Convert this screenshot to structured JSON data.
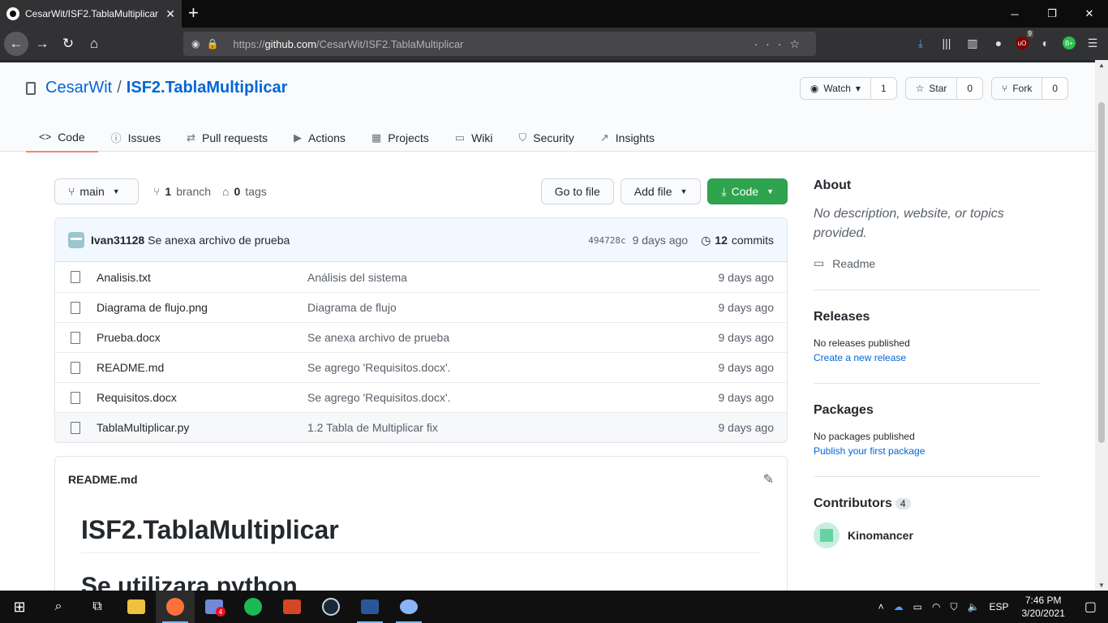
{
  "browser": {
    "tab_title": "CesarWit/ISF2.TablaMultiplicar",
    "tab_close": "✕",
    "new_tab": "+",
    "url_prefix": "https://",
    "url_domain": "github.com",
    "url_path": "/CesarWit/ISF2.TablaMultiplicar",
    "ubo_count": "9"
  },
  "repo": {
    "owner": "CesarWit",
    "separator": "/",
    "name": "ISF2.TablaMultiplicar",
    "watch_label": "Watch",
    "watch_count": "1",
    "star_label": "Star",
    "star_count": "0",
    "fork_label": "Fork",
    "fork_count": "0"
  },
  "tabs": [
    {
      "label": "Code",
      "icon": "code-icon"
    },
    {
      "label": "Issues",
      "icon": "issue-icon"
    },
    {
      "label": "Pull requests",
      "icon": "pull-request-icon"
    },
    {
      "label": "Actions",
      "icon": "play-icon"
    },
    {
      "label": "Projects",
      "icon": "project-icon"
    },
    {
      "label": "Wiki",
      "icon": "book-icon"
    },
    {
      "label": "Security",
      "icon": "shield-icon"
    },
    {
      "label": "Insights",
      "icon": "graph-icon"
    }
  ],
  "filenav": {
    "branch": "main",
    "branch_count": "1",
    "branch_label": "branch",
    "tag_count": "0",
    "tag_label": "tags",
    "go_to_file": "Go to file",
    "add_file": "Add file",
    "code": "Code"
  },
  "commit": {
    "author": "Ivan31128",
    "message": "Se anexa archivo de prueba",
    "sha": "494728c",
    "age": "9 days ago",
    "count": "12",
    "count_label": "commits"
  },
  "files": [
    {
      "name": "Analisis.txt",
      "message": "Análisis del sistema",
      "age": "9 days ago"
    },
    {
      "name": "Diagrama de flujo.png",
      "message": "Diagrama de flujo",
      "age": "9 days ago"
    },
    {
      "name": "Prueba.docx",
      "message": "Se anexa archivo de prueba",
      "age": "9 days ago"
    },
    {
      "name": "README.md",
      "message": "Se agrego 'Requisitos.docx'.",
      "age": "9 days ago"
    },
    {
      "name": "Requisitos.docx",
      "message": "Se agrego 'Requisitos.docx'.",
      "age": "9 days ago"
    },
    {
      "name": "TablaMultiplicar.py",
      "message": "1.2 Tabla de Multiplicar fix",
      "age": "9 days ago"
    }
  ],
  "readme": {
    "filename": "README.md",
    "h1": "ISF2.TablaMultiplicar",
    "h2": "Se utilizara python"
  },
  "sidebar": {
    "about_title": "About",
    "about_desc": "No description, website, or topics provided.",
    "readme_link": "Readme",
    "releases_title": "Releases",
    "releases_text": "No releases published",
    "releases_link": "Create a new release",
    "packages_title": "Packages",
    "packages_text": "No packages published",
    "packages_link": "Publish your first package",
    "contributors_title": "Contributors",
    "contributors_count": "4",
    "contributor_name": "Kinomancer"
  },
  "taskbar": {
    "lang": "ESP",
    "time": "7:46 PM",
    "date": "3/20/2021",
    "discord_badge": "4"
  },
  "colors": {
    "accent_link": "#0366d6",
    "green_button": "#2ea44f",
    "tab_underline": "#f9826c"
  }
}
